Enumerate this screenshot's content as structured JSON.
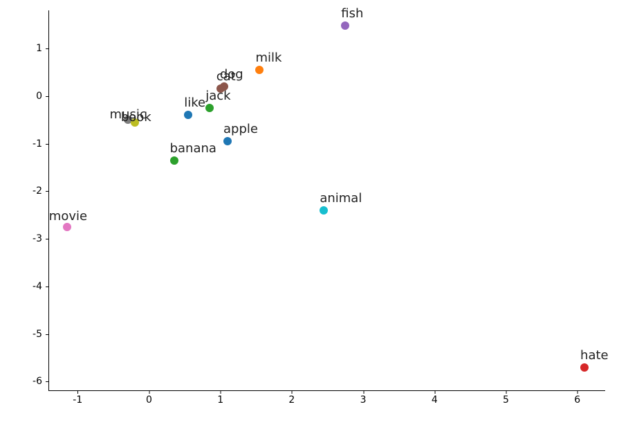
{
  "chart_data": {
    "type": "scatter",
    "xlim": [
      -1.4,
      6.4
    ],
    "ylim": [
      -6.2,
      1.8
    ],
    "xticks": [
      -1,
      0,
      1,
      2,
      3,
      4,
      5,
      6
    ],
    "yticks": [
      -6,
      -5,
      -4,
      -3,
      -2,
      -1,
      0,
      1
    ],
    "title": "",
    "xlabel": "",
    "ylabel": "",
    "points": [
      {
        "label": "movie",
        "x": -1.15,
        "y": -2.75,
        "color": "#e377c2"
      },
      {
        "label": "music",
        "x": -0.3,
        "y": -0.5,
        "color": "#7f7f7f"
      },
      {
        "label": "book",
        "x": -0.2,
        "y": -0.55,
        "color": "#bcbd22"
      },
      {
        "label": "banana",
        "x": 0.35,
        "y": -1.35,
        "color": "#2ca02c"
      },
      {
        "label": "like",
        "x": 0.55,
        "y": -0.4,
        "color": "#1f77b4"
      },
      {
        "label": "jack",
        "x": 0.85,
        "y": -0.25,
        "color": "#2ca02c"
      },
      {
        "label": "cat",
        "x": 1.0,
        "y": 0.15,
        "color": "#8c564b"
      },
      {
        "label": "dog",
        "x": 1.05,
        "y": 0.2,
        "color": "#8c564b"
      },
      {
        "label": "apple",
        "x": 1.1,
        "y": -0.95,
        "color": "#1f77b4"
      },
      {
        "label": "milk",
        "x": 1.55,
        "y": 0.55,
        "color": "#ff7f0e"
      },
      {
        "label": "animal",
        "x": 2.45,
        "y": -2.4,
        "color": "#17becf"
      },
      {
        "label": "fish",
        "x": 2.75,
        "y": 1.48,
        "color": "#9467bd"
      },
      {
        "label": "hate",
        "x": 6.1,
        "y": -5.7,
        "color": "#d62728"
      }
    ],
    "label_offsets": {
      "music": {
        "dx": "-26px",
        "dy": "-18px"
      },
      "book": {
        "dx": "-20px",
        "dy": "-18px"
      },
      "movie": {
        "dx": "-26px",
        "dy": "-26px"
      }
    },
    "overlapping_label_pair": "music_book",
    "music_book_combined_render": "music/book (overlapping)"
  }
}
